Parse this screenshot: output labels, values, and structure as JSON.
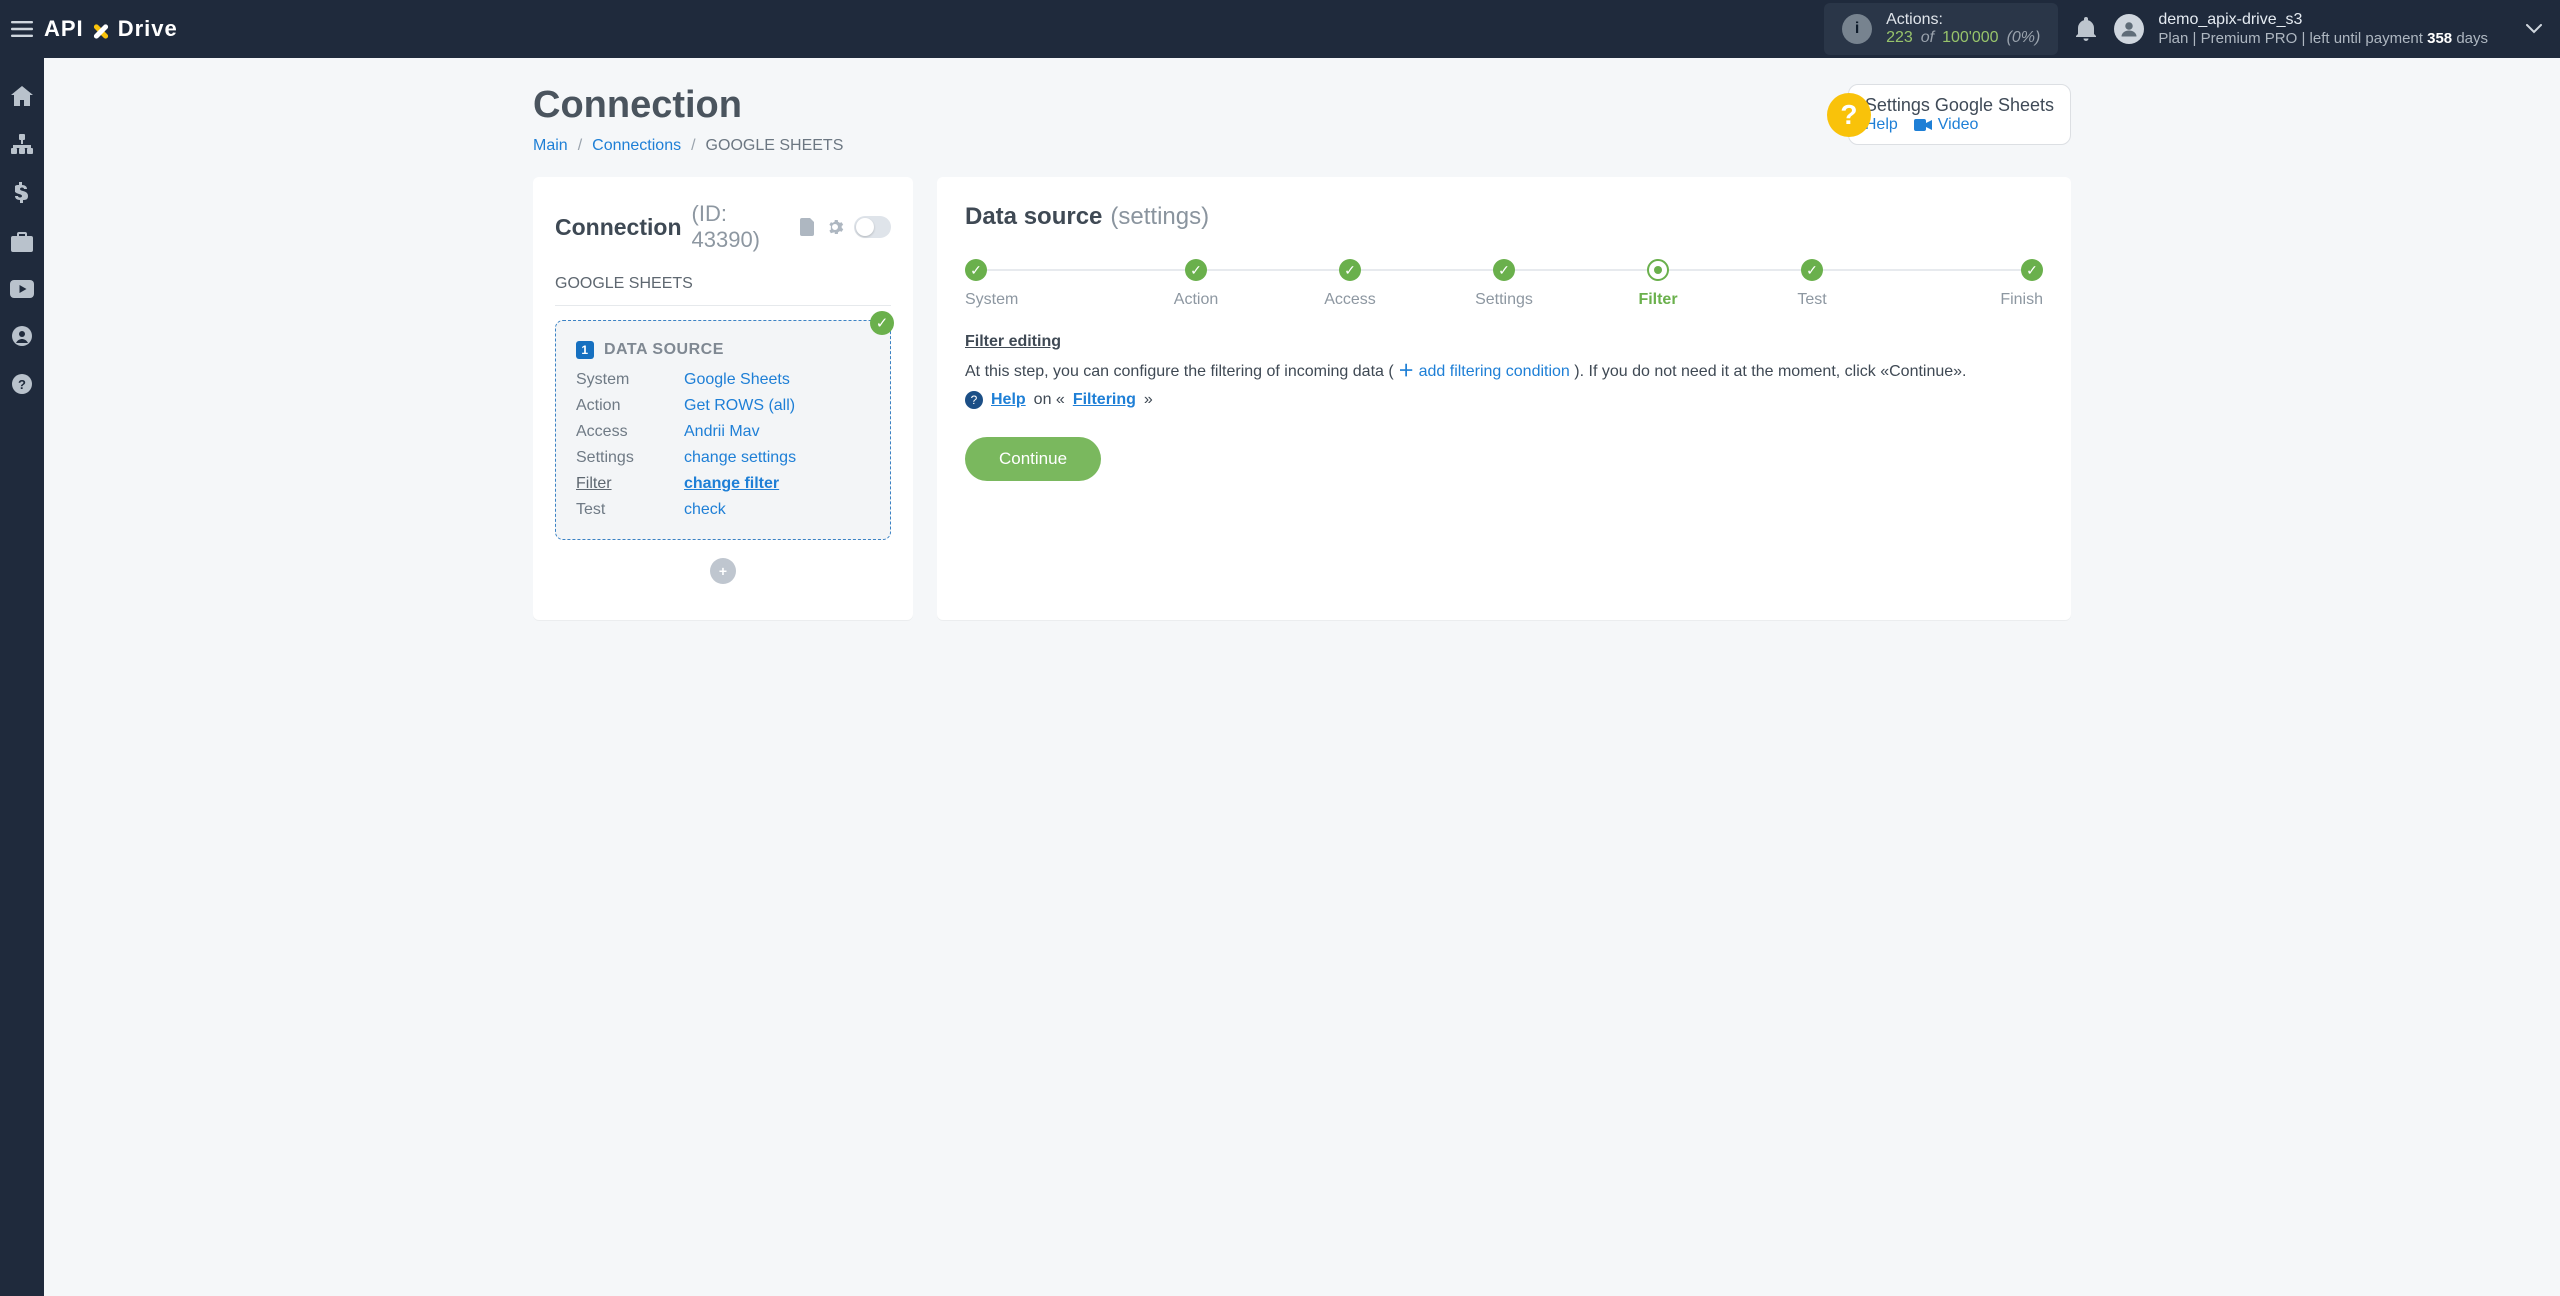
{
  "header": {
    "logo": {
      "api": "API",
      "drive": "Drive"
    },
    "actions": {
      "label": "Actions:",
      "used": "223",
      "of": "of",
      "limit": "100'000",
      "pct": "(0%)"
    },
    "account": {
      "name": "demo_apix-drive_s3",
      "plan_prefix": "Plan |",
      "plan_name": "Premium PRO",
      "plan_mid": "| left until payment",
      "days": "358",
      "days_suffix": "days"
    }
  },
  "page": {
    "title": "Connection",
    "crumbs": {
      "main": "Main",
      "connections": "Connections",
      "current": "GOOGLE SHEETS"
    },
    "help_card": {
      "title": "Settings Google Sheets",
      "help": "Help",
      "video": "Video"
    }
  },
  "left_card": {
    "title": "Connection",
    "id_label": "(ID: 43390)",
    "subname": "GOOGLE SHEETS",
    "data_source_title": "DATA SOURCE",
    "rows": {
      "system": {
        "k": "System",
        "v": "Google Sheets"
      },
      "action": {
        "k": "Action",
        "v": "Get ROWS (all)"
      },
      "access": {
        "k": "Access",
        "v": "Andrii Mav"
      },
      "settings": {
        "k": "Settings",
        "v": "change settings"
      },
      "filter": {
        "k": "Filter",
        "v": "change filter"
      },
      "test": {
        "k": "Test",
        "v": "check"
      }
    }
  },
  "right_card": {
    "title": "Data source",
    "subtitle": "(settings)",
    "steps": [
      {
        "label": "System",
        "state": "done"
      },
      {
        "label": "Action",
        "state": "done"
      },
      {
        "label": "Access",
        "state": "done"
      },
      {
        "label": "Settings",
        "state": "done"
      },
      {
        "label": "Filter",
        "state": "current"
      },
      {
        "label": "Test",
        "state": "done"
      },
      {
        "label": "Finish",
        "state": "done"
      }
    ],
    "section_title": "Filter editing",
    "desc_prefix": "At this step, you can configure the filtering of incoming data (",
    "add_link": "add filtering condition",
    "desc_suffix": "). If you do not need it at the moment, click «Continue».",
    "help_label": "Help",
    "help_on": " on «",
    "help_topic": "Filtering",
    "help_close": "»",
    "continue": "Continue"
  },
  "icons": {
    "check": "✓",
    "plus": "+",
    "info": "i",
    "question": "?"
  }
}
